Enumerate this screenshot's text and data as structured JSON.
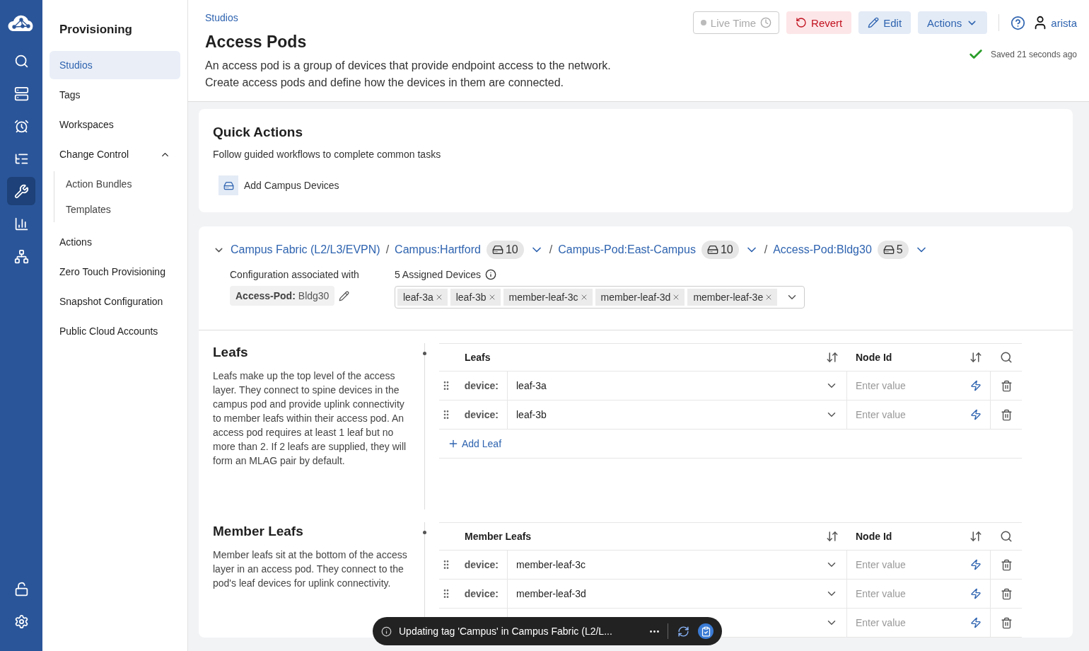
{
  "rail": {
    "top": [
      {
        "kind": "search",
        "selected": false
      },
      {
        "kind": "devices",
        "selected": false
      },
      {
        "kind": "events",
        "selected": false
      },
      {
        "kind": "tasks",
        "selected": false
      },
      {
        "kind": "provisioning",
        "selected": true
      },
      {
        "kind": "dashboards",
        "selected": false
      },
      {
        "kind": "topology",
        "selected": false
      }
    ],
    "bottom": [
      {
        "kind": "lock",
        "selected": false
      },
      {
        "kind": "settings",
        "selected": false
      }
    ]
  },
  "sidebar": {
    "title": "Provisioning",
    "items": [
      {
        "label": "Studios",
        "selected": true
      },
      {
        "label": "Tags",
        "selected": false
      },
      {
        "label": "Workspaces",
        "selected": false
      },
      {
        "label": "Change Control",
        "selected": false,
        "expanded": true,
        "children": [
          {
            "label": "Action Bundles",
            "selected": false
          },
          {
            "label": "Templates",
            "selected": false
          }
        ]
      },
      {
        "label": "Actions",
        "selected": false
      },
      {
        "label": "Zero Touch Provisioning",
        "selected": false
      },
      {
        "label": "Snapshot Configuration",
        "selected": false
      },
      {
        "label": "Public Cloud Accounts",
        "selected": false
      }
    ]
  },
  "header": {
    "breadcrumb": "Studios",
    "title": "Access Pods",
    "description": [
      "An access pod is a group of devices that provide endpoint access to the network.",
      "Create access pods and define how the devices in them are connected."
    ],
    "live_time": {
      "label": "Live Time",
      "disabled": true
    },
    "buttons": [
      {
        "kind": "revert",
        "label": "Revert"
      },
      {
        "kind": "edit",
        "label": "Edit"
      },
      {
        "kind": "menu",
        "label": "Actions"
      }
    ],
    "user": "arista",
    "saved": "Saved 21 seconds ago"
  },
  "quick_actions": {
    "title": "Quick Actions",
    "subtitle": "Follow guided workflows to complete common tasks",
    "actions": [
      "Add Campus Devices"
    ]
  },
  "pod": {
    "expanded": true,
    "path": [
      {
        "label": "Campus Fabric (L2/L3/EVPN)"
      },
      {
        "label": "Campus:Hartford",
        "count": "10"
      },
      {
        "label": "Campus-Pod:East-Campus",
        "count": "10"
      },
      {
        "label": "Access-Pod:Bldg30",
        "count": "5"
      }
    ],
    "separator": "/",
    "config_label": "Configuration associated with",
    "tag_key": "Access-Pod:",
    "tag_value": "Bldg30",
    "assigned_label": "5 Assigned Devices",
    "devices": [
      "leaf-3a",
      "leaf-3b",
      "member-leaf-3c",
      "member-leaf-3d",
      "member-leaf-3e"
    ]
  },
  "sections": [
    {
      "title": "Leafs",
      "description": "Leafs make up the top level of the access layer. They connect to spine devices in the campus pod and provide uplink connectivity to member leafs within their access pod. An access pod requires at least 1 leaf but no more than 2. If 2 leafs are supplied, they will form an MLAG pair by default.",
      "columns": [
        "Leafs",
        "Node Id"
      ],
      "rows": [
        {
          "label": "device:",
          "value": "leaf-3a",
          "placeholder": "Enter value"
        },
        {
          "label": "device:",
          "value": "leaf-3b",
          "placeholder": "Enter value"
        }
      ],
      "add_label": "Add Leaf"
    },
    {
      "title": "Member Leafs",
      "description": "Member leafs sit at the bottom of the access layer in an access pod. They connect to the pod's leaf devices for uplink connectivity.",
      "columns": [
        "Member Leafs",
        "Node Id"
      ],
      "rows": [
        {
          "label": "device:",
          "value": "member-leaf-3c",
          "placeholder": "Enter value"
        },
        {
          "label": "device:",
          "value": "member-leaf-3d",
          "placeholder": "Enter value"
        },
        {
          "placeholder": "Enter value"
        }
      ]
    }
  ],
  "toast": {
    "message": "Updating tag 'Campus' in Campus Fabric (L2/L..."
  }
}
